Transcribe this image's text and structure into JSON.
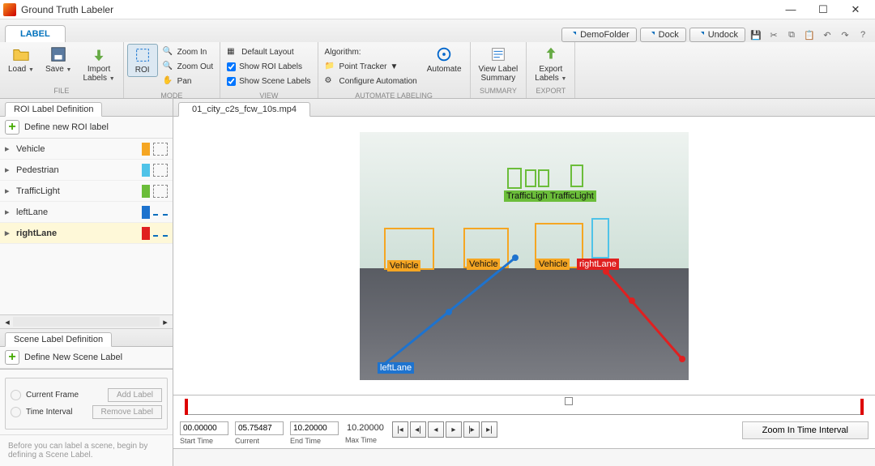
{
  "window": {
    "title": "Ground Truth Labeler"
  },
  "tab": {
    "label": "LABEL"
  },
  "titlebar_menu": {
    "demo": "DemoFolder",
    "dock": "Dock",
    "undock": "Undock"
  },
  "toolstrip": {
    "file": {
      "load": "Load",
      "save": "Save",
      "import": "Import\nLabels",
      "group": "FILE"
    },
    "mode": {
      "roi": "ROI",
      "zoomin": "Zoom In",
      "zoomout": "Zoom Out",
      "pan": "Pan",
      "group": "MODE"
    },
    "view": {
      "default": "Default Layout",
      "showroi": "Show ROI Labels",
      "showscene": "Show Scene Labels",
      "group": "VIEW"
    },
    "algo": {
      "title": "Algorithm:",
      "picker": "Point Tracker",
      "config": "Configure Automation",
      "automate": "Automate",
      "group": "AUTOMATE LABELING"
    },
    "summary": {
      "btn": "View Label\nSummary",
      "group": "SUMMARY"
    },
    "export": {
      "btn": "Export\nLabels",
      "group": "EXPORT"
    }
  },
  "roi_panel": {
    "tab": "ROI Label Definition",
    "define": "Define new ROI label",
    "items": [
      {
        "name": "Vehicle",
        "color": "#f5a623",
        "shape": "rect"
      },
      {
        "name": "Pedestrian",
        "color": "#4fc3e8",
        "shape": "rect"
      },
      {
        "name": "TrafficLight",
        "color": "#6bbd3a",
        "shape": "rect"
      },
      {
        "name": "leftLane",
        "color": "#1e73ce",
        "shape": "line"
      },
      {
        "name": "rightLane",
        "color": "#e02020",
        "shape": "line"
      }
    ],
    "selected": 4
  },
  "scene_panel": {
    "tab": "Scene Label Definition",
    "define": "Define New Scene Label",
    "opt1": "Current Frame",
    "opt2": "Time Interval",
    "add": "Add Label",
    "remove": "Remove Label",
    "hint": "Before you can label a scene, begin by defining a Scene Label."
  },
  "video": {
    "tab": "01_city_c2s_fcw_10s.mp4"
  },
  "timeline": {
    "start": {
      "val": "00.00000",
      "cap": "Start Time"
    },
    "current": {
      "val": "05.75487",
      "cap": "Current"
    },
    "end": {
      "val": "10.20000",
      "cap": "End Time"
    },
    "max": {
      "val": "10.20000",
      "cap": "Max Time"
    },
    "zoom_btn": "Zoom In Time Interval"
  },
  "annotations": {
    "vehicle": "Vehicle",
    "traffic": "TrafficLight",
    "left": "leftLane",
    "right": "rightLane"
  }
}
